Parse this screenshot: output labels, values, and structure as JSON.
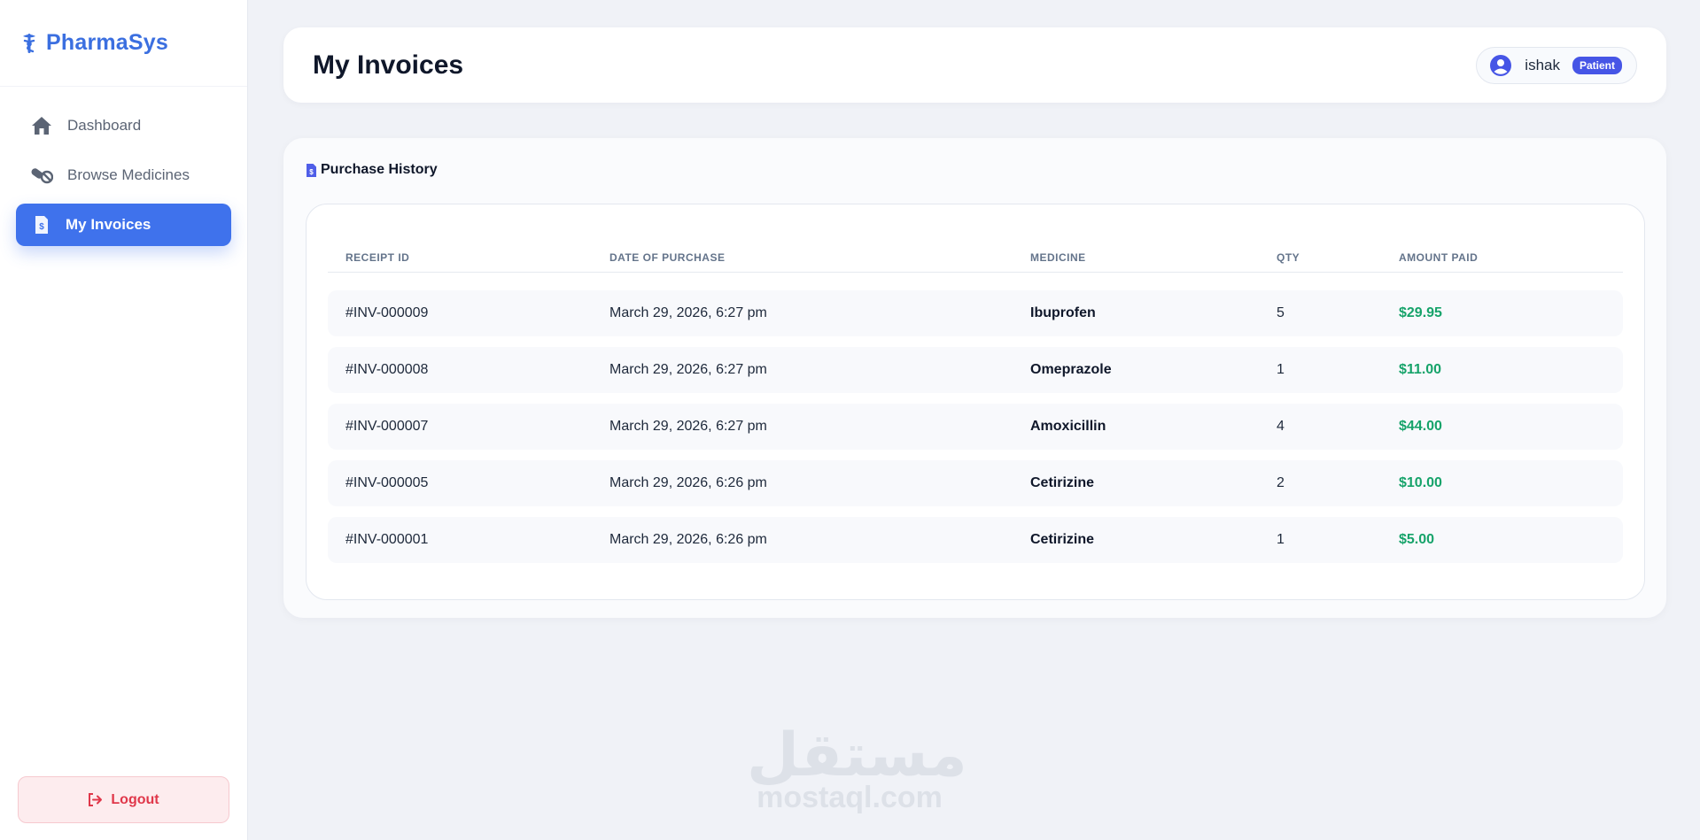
{
  "brand": {
    "name": "PharmaSys"
  },
  "sidebar": {
    "items": [
      {
        "label": "Dashboard",
        "icon": "home-icon"
      },
      {
        "label": "Browse Medicines",
        "icon": "pills-icon"
      },
      {
        "label": "My Invoices",
        "icon": "invoice-icon",
        "active": true
      }
    ],
    "logout_label": "Logout"
  },
  "header": {
    "title": "My Invoices",
    "user": {
      "name": "ishak",
      "role": "Patient"
    }
  },
  "purchase_history": {
    "title": "Purchase History",
    "columns": [
      "RECEIPT ID",
      "DATE OF PURCHASE",
      "MEDICINE",
      "QTY",
      "AMOUNT PAID"
    ],
    "rows": [
      {
        "receipt_id": "#INV-000009",
        "date": "March 29, 2026, 6:27 pm",
        "medicine": "Ibuprofen",
        "qty": "5",
        "amount": "$29.95"
      },
      {
        "receipt_id": "#INV-000008",
        "date": "March 29, 2026, 6:27 pm",
        "medicine": "Omeprazole",
        "qty": "1",
        "amount": "$11.00"
      },
      {
        "receipt_id": "#INV-000007",
        "date": "March 29, 2026, 6:27 pm",
        "medicine": "Amoxicillin",
        "qty": "4",
        "amount": "$44.00"
      },
      {
        "receipt_id": "#INV-000005",
        "date": "March 29, 2026, 6:26 pm",
        "medicine": "Cetirizine",
        "qty": "2",
        "amount": "$10.00"
      },
      {
        "receipt_id": "#INV-000001",
        "date": "March 29, 2026, 6:26 pm",
        "medicine": "Cetirizine",
        "qty": "1",
        "amount": "$5.00"
      }
    ]
  },
  "watermark": {
    "arabic": "مستقل",
    "latin": "mostaql.com"
  },
  "colors": {
    "brand": "#3b6fe0",
    "active_nav": "#3f72ec",
    "amount": "#16a36a",
    "logout": "#e0374a",
    "role_badge": "#4655e6"
  }
}
